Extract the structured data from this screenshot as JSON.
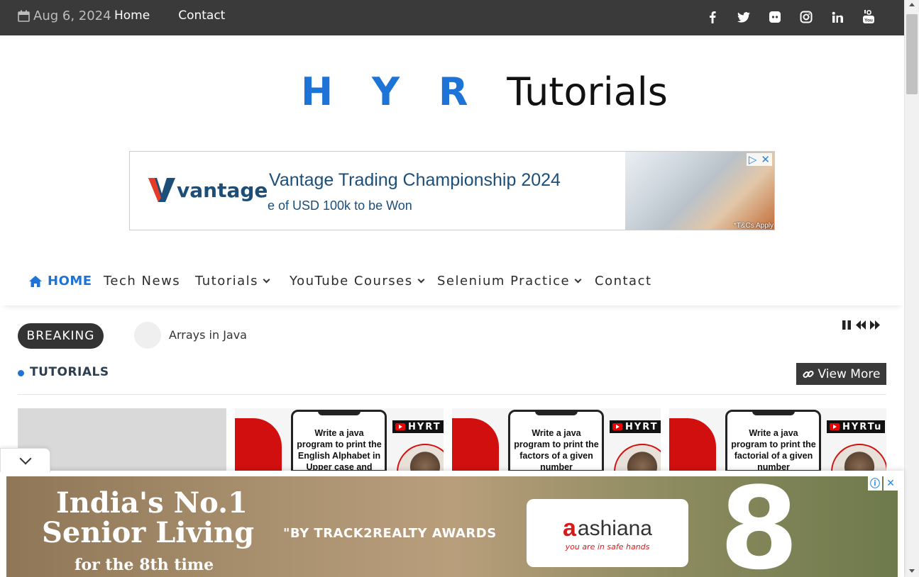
{
  "topbar": {
    "date": "Aug 6, 2024",
    "nav": [
      "Home",
      "Contact"
    ],
    "social": [
      {
        "icon": "facebook-icon",
        "glyph": "f"
      },
      {
        "icon": "twitter-icon",
        "glyph": "🐦"
      },
      {
        "icon": "discord-icon",
        "glyph": "◙"
      },
      {
        "icon": "instagram-icon",
        "glyph": "◎"
      },
      {
        "icon": "linkedin-icon",
        "glyph": "in"
      },
      {
        "icon": "youtube-icon",
        "glyph": "▶"
      }
    ]
  },
  "logo": {
    "hyr": "HYR",
    "tutorials": "Tutorials"
  },
  "ad_top": {
    "brand": "vantage",
    "headline": "Vantage Trading Championship 2024",
    "sub": "e of USD 100k to be Won",
    "tc": "*T&Cs Apply"
  },
  "mainnav": {
    "items": [
      {
        "label": "HOME",
        "active": true
      },
      {
        "label": "Tech News"
      },
      {
        "label": "Tutorials",
        "dropdown": true
      },
      {
        "label": "YouTube Courses",
        "dropdown": true
      },
      {
        "label": "Selenium Practice",
        "dropdown": true
      },
      {
        "label": "Contact"
      }
    ]
  },
  "breaking": {
    "label": "BREAKING",
    "headline": "Arrays in Java"
  },
  "section": {
    "title": "TUTORIALS",
    "view_more": "View More"
  },
  "cards": [
    {
      "text": ""
    },
    {
      "text": "Write a java program to print the English Alphabet in Upper case and Lower case",
      "channel": "HYRT"
    },
    {
      "text": "Write a java program to print the factors of a given number",
      "channel": "HYRT"
    },
    {
      "text": "Write a java program to print the factorial of a given number",
      "channel": "HYRTu"
    }
  ],
  "ad_bottom": {
    "line1": "India's No.1",
    "line2": "Senior Living",
    "line3": "for the 8th time",
    "award": "\"BY TRACK2REALTY AWARDS",
    "brand": "ashiana",
    "tagline": "you are in safe hands",
    "big_number": "8"
  },
  "colors": {
    "accent": "#1e73d6",
    "topbar": "#3a3a3a",
    "brand_red": "#d20f0f"
  }
}
